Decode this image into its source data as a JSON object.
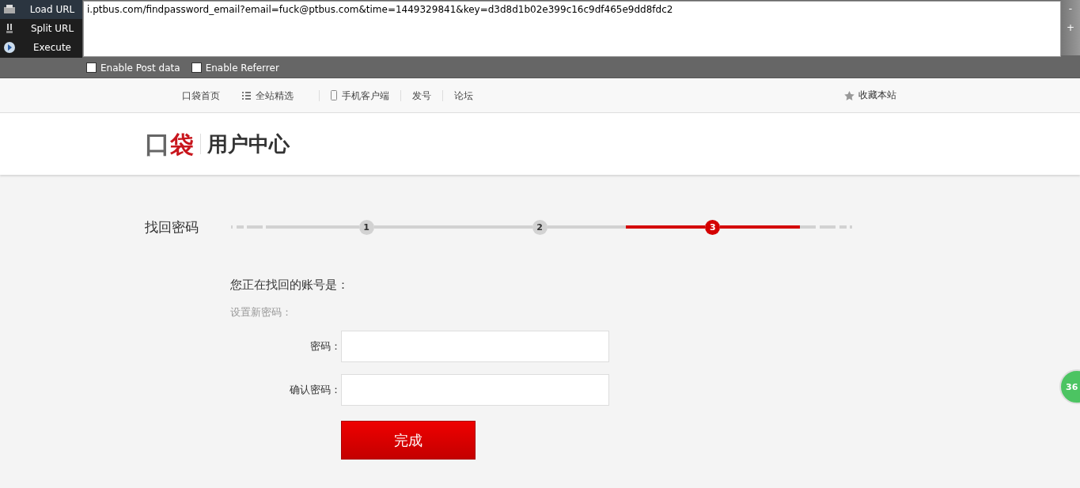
{
  "toolbar": {
    "buttons": [
      {
        "label": "Load URL",
        "kind": "load"
      },
      {
        "label": "Split URL",
        "kind": "split"
      },
      {
        "label": "Execute",
        "kind": "execute"
      }
    ],
    "url": "i.ptbus.com/findpassword_email?email=fuck@ptbus.com&time=1449329841&key=d3d8d1b02e399c16c9df465e9dd8fdc2",
    "zoom_out": "-",
    "zoom_in": "+",
    "options": [
      {
        "label": "Enable Post data",
        "checked": false
      },
      {
        "label": "Enable Referrer",
        "checked": false
      }
    ]
  },
  "nav": {
    "items": [
      {
        "label": "口袋首页",
        "kind": "plain"
      },
      {
        "label": "全站精选",
        "kind": "list"
      },
      {
        "label": "手机客户端",
        "kind": "phone"
      },
      {
        "label": "发号",
        "kind": "plain"
      },
      {
        "label": "论坛",
        "kind": "plain"
      }
    ],
    "bookmark": "收藏本站"
  },
  "header": {
    "logo_left": "口",
    "logo_right": "袋",
    "title": "用户中心"
  },
  "steps": {
    "title": "找回密码",
    "items": [
      {
        "label": "1",
        "selected": false
      },
      {
        "label": "2",
        "selected": false
      },
      {
        "label": "3",
        "selected": true
      }
    ]
  },
  "form": {
    "account_label": "您正在找回的账号是：",
    "section_label": "设置新密码：",
    "fields": [
      {
        "label": "密码："
      },
      {
        "label": "确认密码："
      }
    ],
    "submit": "完成"
  },
  "side_badge": "36"
}
